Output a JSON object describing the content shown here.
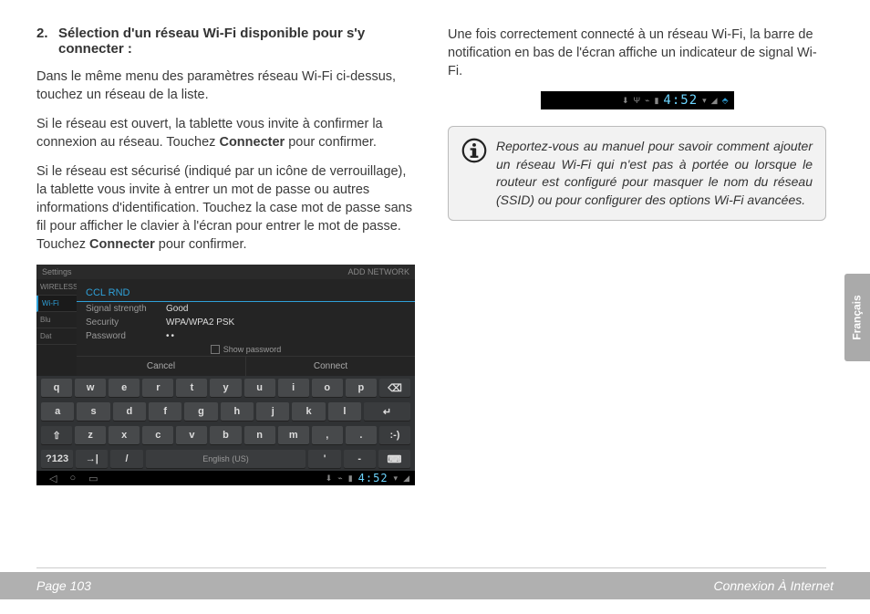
{
  "section": {
    "number": "2.",
    "title": "Sélection d'un réseau Wi-Fi disponible pour s'y connecter :"
  },
  "para1": "Dans le même menu des paramètres réseau Wi-Fi ci-dessus, touchez un réseau de la liste.",
  "para2a": "Si le réseau est ouvert, la tablette vous invite à confirmer la connexion au réseau. Touchez ",
  "para2b": "Connecter",
  "para2c": " pour confirmer.",
  "para3a": "Si le réseau est sécurisé (indiqué par un icône de verrouillage), la tablette vous invite à entrer un mot de passe ou autres informations d'identification. Touchez la case mot de passe sans fil pour afficher le clavier à l'écran pour entrer le mot de passe. Touchez ",
  "para3b": "Connecter",
  "para3c": " pour confirmer.",
  "right_para": "Une fois correctement connecté à un réseau Wi-Fi, la barre de notification en bas de l'écran affiche un indicateur de signal Wi-Fi.",
  "info_text": "Reportez-vous au manuel pour savoir comment ajouter un réseau Wi-Fi qui n'est pas à portée ou lorsque le routeur est configuré pour masquer le nom du réseau (SSID) ou pour configurer des options Wi-Fi avancées.",
  "sidetab": "Français",
  "footer": {
    "page": "Page 103",
    "chapter": "Connexion À Internet"
  },
  "dialog": {
    "top_left": "Settings",
    "top_right": "ADD NETWORK",
    "side_header": "WIRELESS",
    "side_wifi": "Wi-Fi",
    "side_bt": "Blu",
    "side_data": "Dat",
    "ssid": "CCL RND",
    "signal_label": "Signal strength",
    "signal_value": "Good",
    "security_label": "Security",
    "security_value": "WPA/WPA2 PSK",
    "password_label": "Password",
    "password_value": "••",
    "showpw": "Show password",
    "cancel": "Cancel",
    "connect": "Connect"
  },
  "keyboard": {
    "r1": [
      "q",
      "w",
      "e",
      "r",
      "t",
      "y",
      "u",
      "i",
      "o",
      "p"
    ],
    "r2": [
      "a",
      "s",
      "d",
      "f",
      "g",
      "h",
      "j",
      "k",
      "l"
    ],
    "r3": [
      "z",
      "x",
      "c",
      "v",
      "b",
      "n",
      "m",
      ",",
      "."
    ],
    "shift": "⇧",
    "back": "⌫",
    "enter": "↵",
    "smile": ":-)",
    "tab": "→|",
    "numkey": "?123",
    "slash": "/",
    "space": "English (US)",
    "apos": "'",
    "dash": "-",
    "kb": "⌨"
  },
  "status": {
    "time": "4:52"
  }
}
